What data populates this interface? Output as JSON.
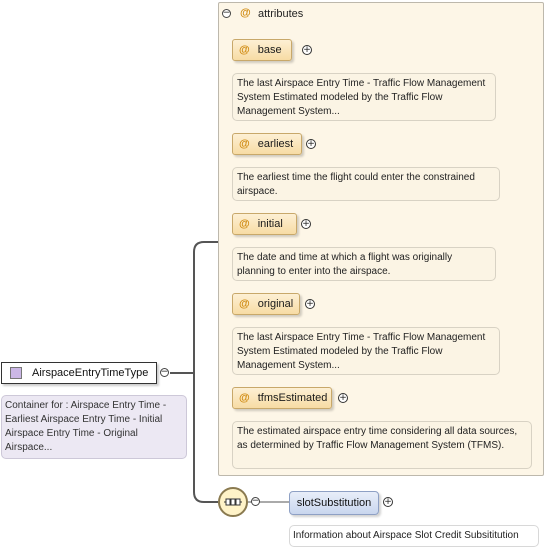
{
  "type": {
    "label": "AirspaceEntryTimeType",
    "description": "Container for : Airspace Entry Time - Earliest Airspace Entry Time - Initial Airspace Entry Time - Original Airspace..."
  },
  "attributes_group": {
    "collapse_symbol": "−",
    "at_symbol": "@",
    "title": "attributes",
    "items": [
      {
        "name": "base",
        "description": "The last Airspace Entry Time - Traffic Flow Management System Estimated modeled by the Traffic Flow Management System..."
      },
      {
        "name": "earliest",
        "description": "The earliest time the flight could enter the constrained airspace."
      },
      {
        "name": "initial",
        "description": "The date and time at which a flight was originally planning to enter into the airspace."
      },
      {
        "name": "original",
        "description": "The last Airspace Entry Time - Traffic Flow Management System Estimated modeled by the Traffic Flow Management System..."
      },
      {
        "name": "tfmsEstimated",
        "description": "The estimated airspace entry time considering all data sources, as determined by Traffic Flow Management System (TFMS)."
      }
    ]
  },
  "symbols": {
    "plus": "+",
    "minus": "−"
  },
  "sequence_element": {
    "name": "slotSubstitution",
    "description": "Information about Airspace Slot Credit Subsititution"
  }
}
